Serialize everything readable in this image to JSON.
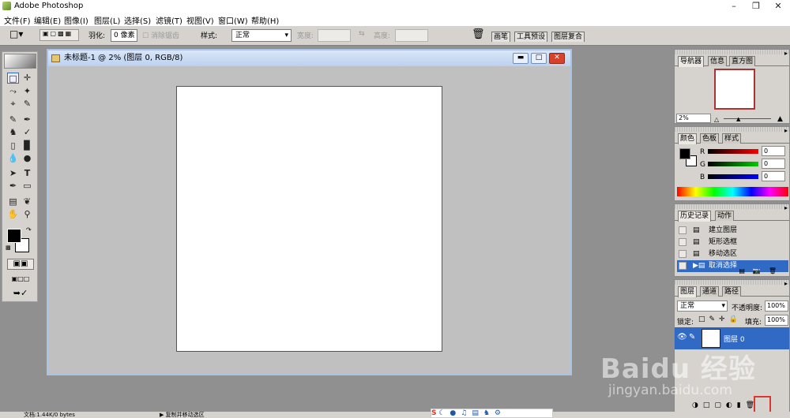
{
  "app": {
    "title": "Adobe Photoshop"
  },
  "menu": [
    "文件(F)",
    "编辑(E)",
    "图像(I)",
    "图层(L)",
    "选择(S)",
    "滤镜(T)",
    "视图(V)",
    "窗口(W)",
    "帮助(H)"
  ],
  "options": {
    "feather_label": "羽化:",
    "feather_value": "0 像素",
    "antialias_label": "消除锯齿",
    "style_label": "样式:",
    "style_value": "正常",
    "width_label": "宽度:",
    "height_label": "高度:",
    "well_tabs": [
      "画笔",
      "工具预设",
      "图层复合"
    ]
  },
  "document": {
    "title": "未标题-1 @ 2% (图层 0, RGB/8)"
  },
  "navigator": {
    "tabs": [
      "导航器",
      "信息",
      "直方图"
    ],
    "zoom": "2%"
  },
  "color": {
    "tabs": [
      "颜色",
      "色板",
      "样式"
    ],
    "channels": [
      {
        "label": "R",
        "value": "0"
      },
      {
        "label": "G",
        "value": "0"
      },
      {
        "label": "B",
        "value": "0"
      }
    ]
  },
  "history": {
    "tabs": [
      "历史记录",
      "动作"
    ],
    "items": [
      "建立图层",
      "矩形选框",
      "移动选区",
      "取消选择"
    ],
    "selected_index": 3
  },
  "layers": {
    "tabs": [
      "图层",
      "通道",
      "路径"
    ],
    "blend_mode": "正常",
    "opacity_label": "不透明度:",
    "opacity_value": "100%",
    "lock_label": "锁定:",
    "fill_label": "填充:",
    "fill_value": "100%",
    "layer_name": "图层 0"
  },
  "status": {
    "doc_info": "文档:1.44K/0 bytes",
    "hint": "▶ 复制并移动选区"
  },
  "watermark": {
    "main": "Baidu 经验",
    "sub": "jingyan.baidu.com"
  },
  "colors": {
    "selection": "#316ac5",
    "doc_border": "#a9c3e6",
    "highlight": "#d8382e"
  }
}
